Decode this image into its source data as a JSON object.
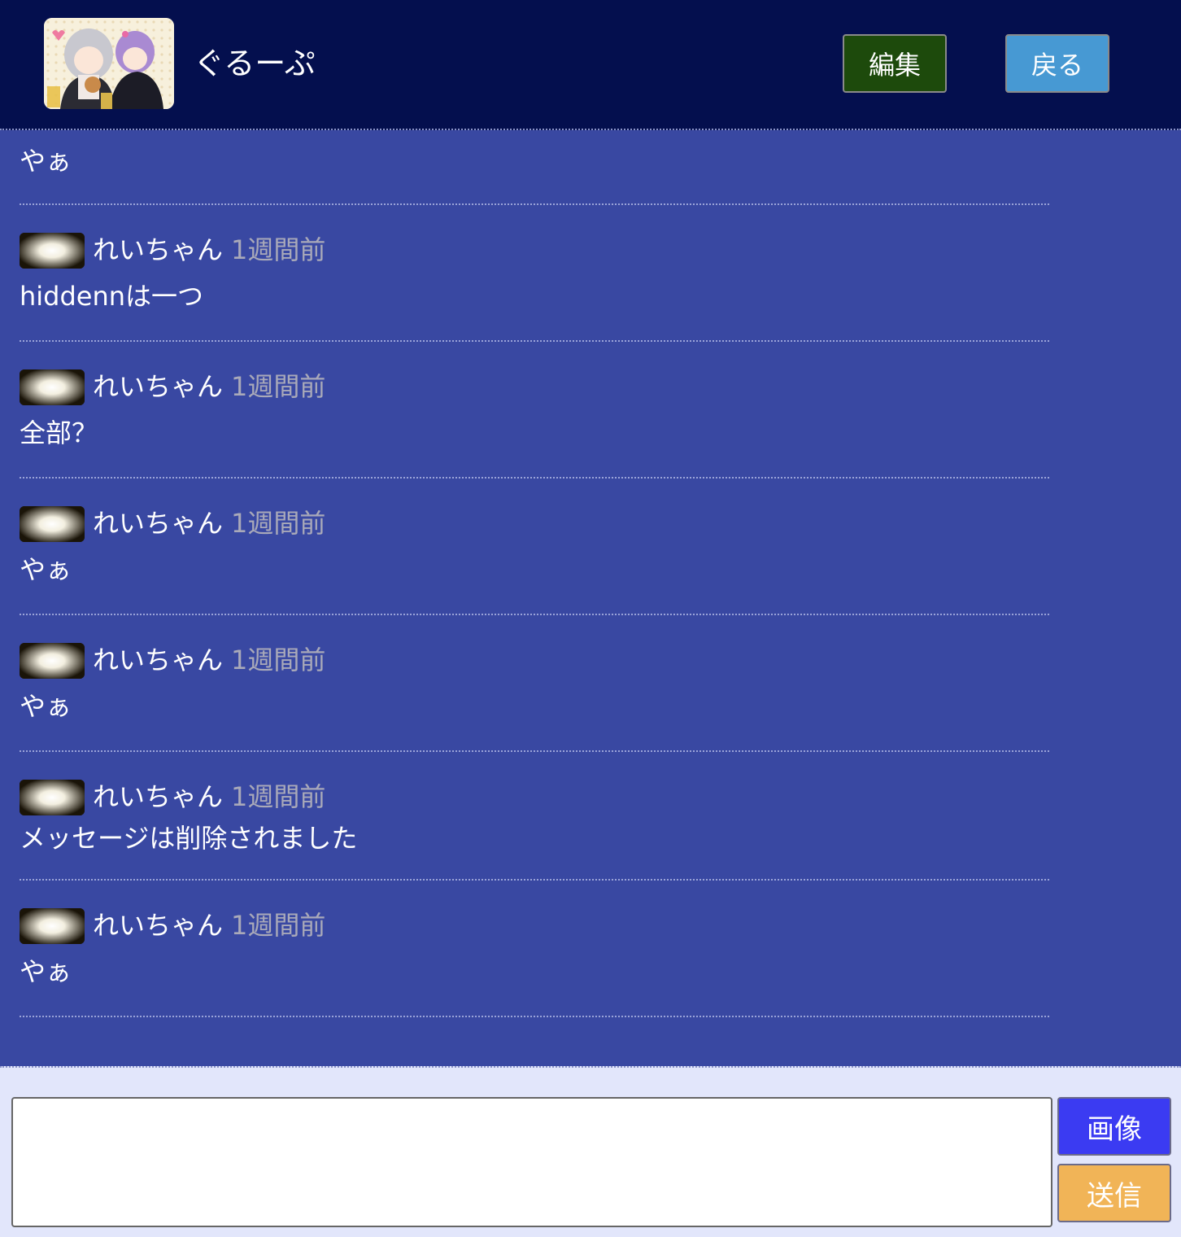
{
  "header": {
    "group_name": "ぐるーぷ",
    "edit_label": "編集",
    "back_label": "戻る"
  },
  "messages": [
    {
      "user": "",
      "time": "",
      "text": "やぁ"
    },
    {
      "user": "れいちゃん",
      "time": "1週間前",
      "text": "hiddennは一つ"
    },
    {
      "user": "れいちゃん",
      "time": "1週間前",
      "text": "全部？"
    },
    {
      "user": "れいちゃん",
      "time": "1週間前",
      "text": "やぁ"
    },
    {
      "user": "れいちゃん",
      "time": "1週間前",
      "text": "やぁ"
    },
    {
      "user": "れいちゃん",
      "time": "1週間前",
      "text": "メッセージは削除されました"
    },
    {
      "user": "れいちゃん",
      "time": "1週間前",
      "text": "やぁ"
    }
  ],
  "composer": {
    "input_value": "",
    "image_label": "画像",
    "send_label": "送信"
  },
  "colors": {
    "header_bg": "#040f4e",
    "chat_bg": "#3948a2",
    "composer_bg": "#e2e6fb",
    "edit_button": "#1d4a0c",
    "back_button": "#4799d3",
    "image_button": "#3b3bf2",
    "send_button": "#f1b457"
  }
}
